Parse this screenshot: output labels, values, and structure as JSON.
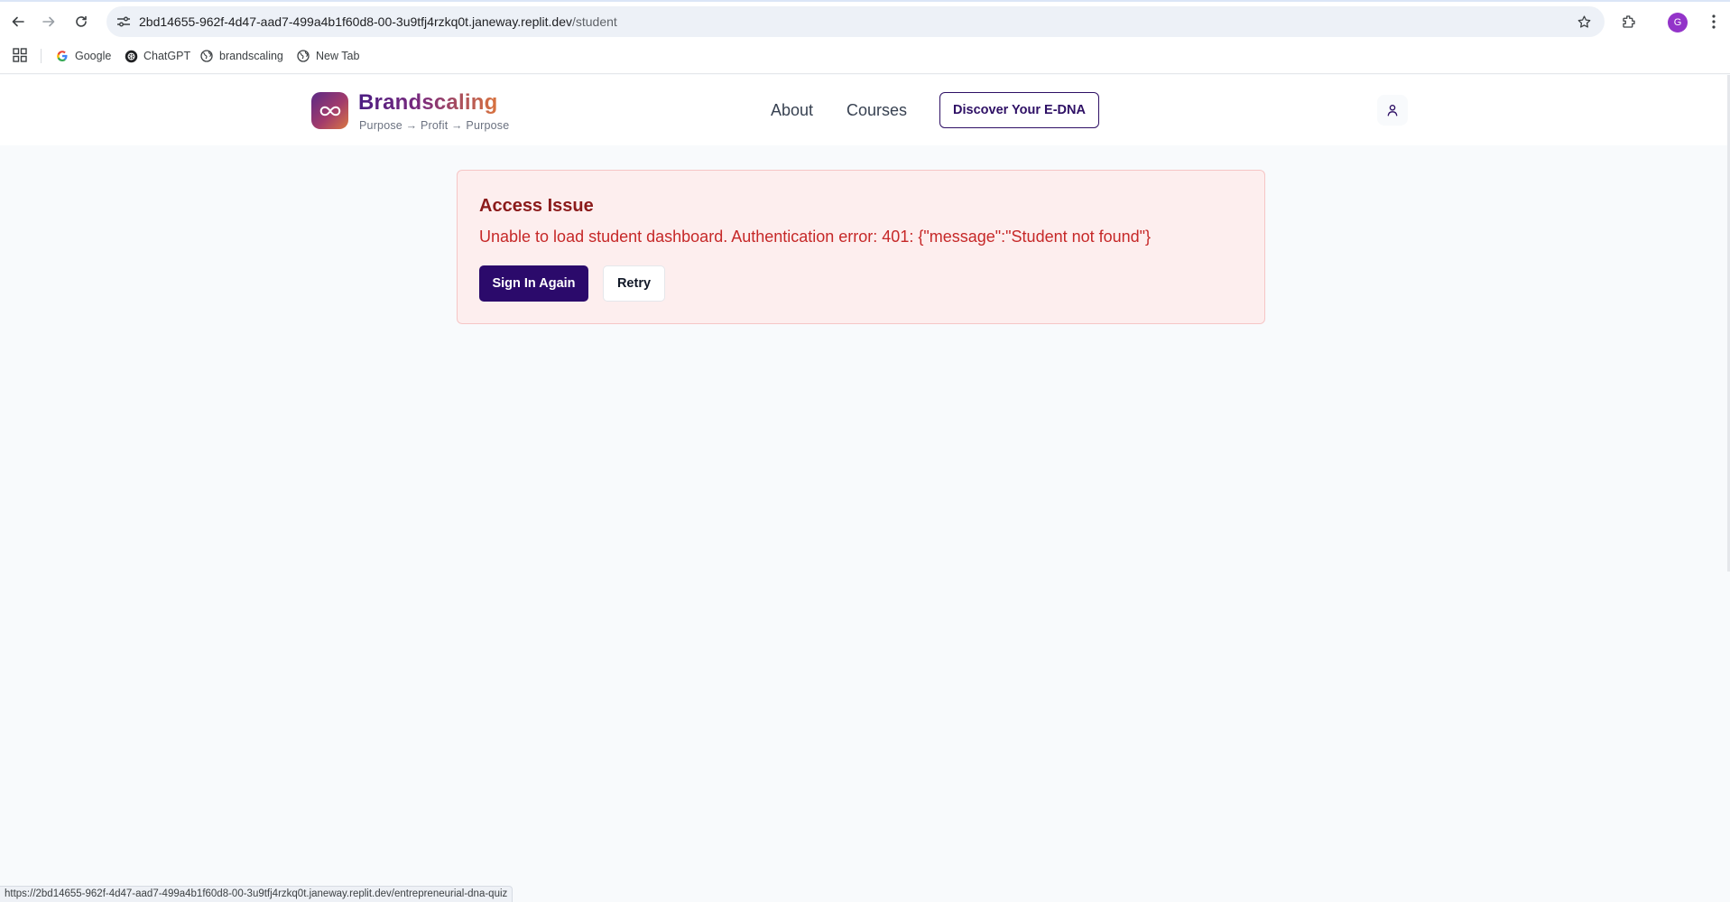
{
  "browser": {
    "url_host": "2bd14655-962f-4d47-aad7-499a4b1f60d8-00-3u9tfj4rzkq0t.janeway.replit.dev",
    "url_path": "/student",
    "profile_initial": "G",
    "bookmarks": [
      {
        "label": "Google",
        "icon": "google-icon"
      },
      {
        "label": "ChatGPT",
        "icon": "chatgpt-icon"
      },
      {
        "label": "brandscaling",
        "icon": "globe-icon"
      },
      {
        "label": "New Tab",
        "icon": "globe-icon"
      }
    ],
    "status_url": "https://2bd14655-962f-4d47-aad7-499a4b1f60d8-00-3u9tfj4rzkq0t.janeway.replit.dev/entrepreneurial-dna-quiz"
  },
  "site": {
    "brand_name": "Brandscaling",
    "tagline": "Purpose → Profit → Purpose",
    "nav": {
      "about": "About",
      "courses": "Courses",
      "cta": "Discover Your E-DNA"
    },
    "colors": {
      "primary": "#2b0a6b",
      "error_text": "#c62828",
      "error_title": "#8b1a1a",
      "error_bg": "#fdeeee"
    }
  },
  "error": {
    "title": "Access Issue",
    "message": "Unable to load student dashboard. Authentication error: 401: {\"message\":\"Student not found\"}",
    "primary_button": "Sign In Again",
    "secondary_button": "Retry"
  }
}
